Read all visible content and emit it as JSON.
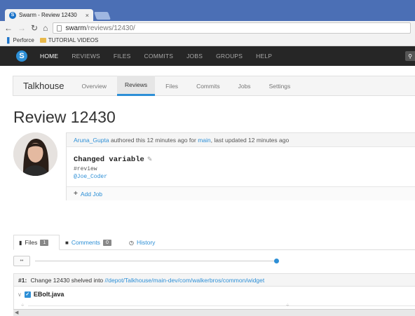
{
  "browser": {
    "tab_title": "Swarm - Review 12430",
    "tab_favicon": "S",
    "tab_close": "×",
    "url_host": "swarm",
    "url_path": "/reviews/12430/",
    "bookmarks": [
      "Perforce",
      "TUTORIAL VIDEOS"
    ]
  },
  "appnav": {
    "logo": "S",
    "items": [
      "HOME",
      "REVIEWS",
      "FILES",
      "COMMITS",
      "JOBS",
      "GROUPS",
      "HELP"
    ],
    "active": "HOME"
  },
  "project": {
    "name": "Talkhouse",
    "tabs": [
      "Overview",
      "Reviews",
      "Files",
      "Commits",
      "Jobs",
      "Settings"
    ],
    "active_tab": "Reviews"
  },
  "page": {
    "title": "Review 12430"
  },
  "review": {
    "author": "Aruna_Gupta",
    "authored_text": " authored this 12 minutes ago for ",
    "project_link": "main",
    "updated_text": ", last updated 12 minutes ago",
    "description": "Changed variable",
    "tag": "#review",
    "mention": "@Joe_Coder",
    "add_job": "Add Job"
  },
  "lower_tabs": {
    "files_label": "Files",
    "files_count": "1",
    "comments_label": "Comments",
    "comments_count": "0",
    "history_label": "History"
  },
  "slider": {
    "dots_label": "••"
  },
  "change": {
    "prefix": "#1:",
    "text": " Change 12430 shelved into ",
    "path": "//depot/Talkhouse/main-dev/com/walkerbros/common/widget"
  },
  "file": {
    "name": "EBolt.java"
  },
  "colors": {
    "accent": "#2d8fd6",
    "navbar": "#262626",
    "tabbar": "#4b6fb5"
  }
}
